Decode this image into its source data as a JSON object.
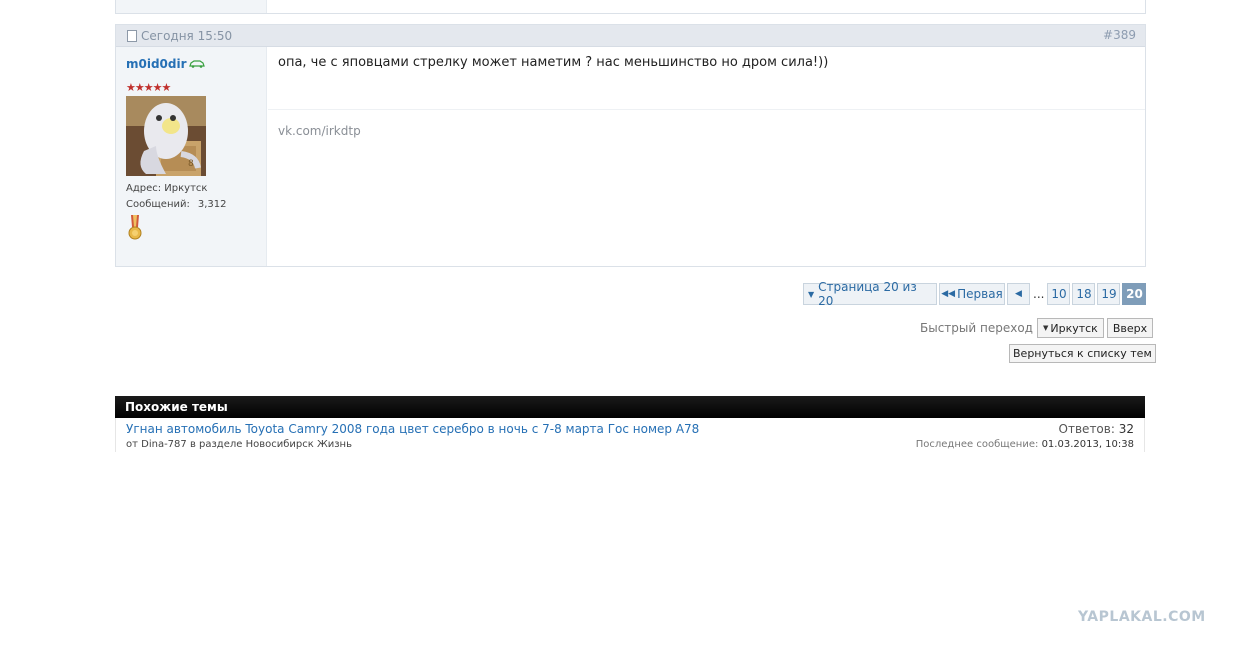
{
  "post": {
    "date": "Сегодня 15:50",
    "number": "#389",
    "username": "m0id0dir",
    "stars": "★★★★★",
    "address": "Адрес: Иркутск",
    "messages_label": "Сообщений:",
    "messages_count": "3,312",
    "text": "опа, че с яповцами стрелку может наметим ? нас меньшинство но дром сила!))",
    "signature": "vk.com/irkdtp"
  },
  "pagination": {
    "page_info": "Страница 20 из 20",
    "first": "Первая",
    "prev": "◂",
    "dots": "...",
    "pages": [
      "10",
      "18",
      "19",
      "20"
    ],
    "current": "20"
  },
  "quick_nav": {
    "label": "Быстрый переход",
    "select": "Иркутск",
    "up": "Вверх",
    "back": "Вернуться к списку тем"
  },
  "similar": {
    "title": "Похожие темы",
    "topics": [
      {
        "title": "Угнан автомобиль Toyota Camry 2008 года цвет серебро в ночь с 7-8 марта Гос номер А78",
        "meta": "от Dina-787 в разделе Новосибирск Жизнь",
        "replies_label": "Ответов:",
        "replies": "32",
        "last_label": "Последнее сообщение:",
        "last_value": "01.03.2013, 10:38"
      }
    ]
  },
  "watermark": "YAPLAKAL.COM",
  "colors": {
    "link": "#2670b5",
    "header_bg": "#e4e8ee",
    "sidebar_bg": "#f2f5f8",
    "star": "#c0302d"
  }
}
